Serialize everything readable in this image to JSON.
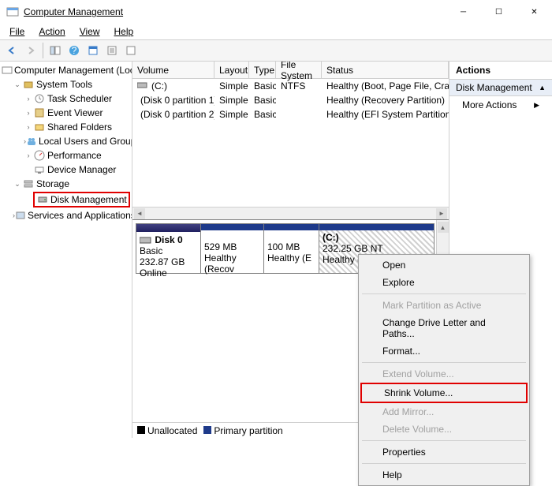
{
  "window": {
    "title": "Computer Management"
  },
  "menu": {
    "file": "File",
    "action": "Action",
    "view": "View",
    "help": "Help"
  },
  "tree": {
    "root": "Computer Management (Local",
    "systemTools": "System Tools",
    "taskScheduler": "Task Scheduler",
    "eventViewer": "Event Viewer",
    "sharedFolders": "Shared Folders",
    "localUsers": "Local Users and Groups",
    "performance": "Performance",
    "deviceManager": "Device Manager",
    "storage": "Storage",
    "diskManagement": "Disk Management",
    "servicesApps": "Services and Applications"
  },
  "cols": {
    "volume": "Volume",
    "layout": "Layout",
    "type": "Type",
    "fileSystem": "File System",
    "status": "Status"
  },
  "rows": [
    {
      "vol": "(C:)",
      "layout": "Simple",
      "type": "Basic",
      "fs": "NTFS",
      "status": "Healthy (Boot, Page File, Crash Du"
    },
    {
      "vol": "(Disk 0 partition 1)",
      "layout": "Simple",
      "type": "Basic",
      "fs": "",
      "status": "Healthy (Recovery Partition)"
    },
    {
      "vol": "(Disk 0 partition 2)",
      "layout": "Simple",
      "type": "Basic",
      "fs": "",
      "status": "Healthy (EFI System Partition)"
    }
  ],
  "disk": {
    "name": "Disk 0",
    "kind": "Basic",
    "size": "232.87 GB",
    "state": "Online",
    "p1": {
      "size": "529 MB",
      "status": "Healthy (Recov"
    },
    "p2": {
      "size": "100 MB",
      "status": "Healthy (E"
    },
    "p3": {
      "label": "(C:)",
      "size": "232.25 GB NT",
      "status": "Healthy (Boo"
    }
  },
  "legend": {
    "unallocated": "Unallocated",
    "primary": "Primary partition"
  },
  "actions": {
    "header": "Actions",
    "section": "Disk Management",
    "more": "More Actions"
  },
  "ctx": {
    "open": "Open",
    "explore": "Explore",
    "markActive": "Mark Partition as Active",
    "changeLetter": "Change Drive Letter and Paths...",
    "format": "Format...",
    "extend": "Extend Volume...",
    "shrink": "Shrink Volume...",
    "addMirror": "Add Mirror...",
    "deleteVol": "Delete Volume...",
    "properties": "Properties",
    "help": "Help"
  }
}
